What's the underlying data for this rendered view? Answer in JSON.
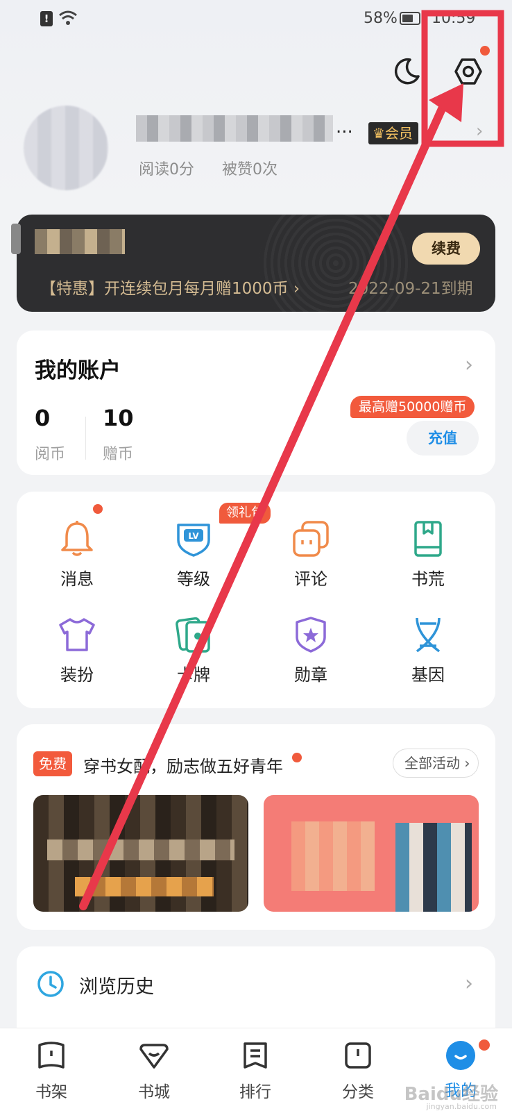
{
  "status_bar": {
    "battery_percent": "58%",
    "time": "10:59"
  },
  "profile": {
    "ellipsis": "...",
    "vip_label": "会员",
    "read_stat": "阅读0分",
    "likes_stat": "被赞0次"
  },
  "member_card": {
    "renew_label": "续费",
    "promo": "【特惠】开连续包月每月赠1000币 ›",
    "expire": "2022-09-21到期"
  },
  "account": {
    "title": "我的账户",
    "coins_value": "0",
    "coins_label": "阅币",
    "gift_value": "10",
    "gift_label": "赠币",
    "promo_pill": "最高赠50000赠币",
    "recharge_label": "充值"
  },
  "features": {
    "gift_tag": "领礼包",
    "items": [
      "消息",
      "等级",
      "评论",
      "书荒",
      "装扮",
      "卡牌",
      "勋章",
      "基因"
    ]
  },
  "activity": {
    "free_tag": "免费",
    "title": "穿书女配，励志做五好青年",
    "all_label": "全部活动"
  },
  "history": {
    "label": "浏览历史"
  },
  "bottom_nav": {
    "items": [
      "书架",
      "书城",
      "排行",
      "分类",
      "我的"
    ]
  },
  "watermark": {
    "brand": "Baidu经验",
    "url": "jingyan.baidu.com"
  },
  "colors": {
    "accent_blue": "#1f8ee6",
    "promo_red": "#f25a3c",
    "annotation_red": "#e8384a"
  }
}
